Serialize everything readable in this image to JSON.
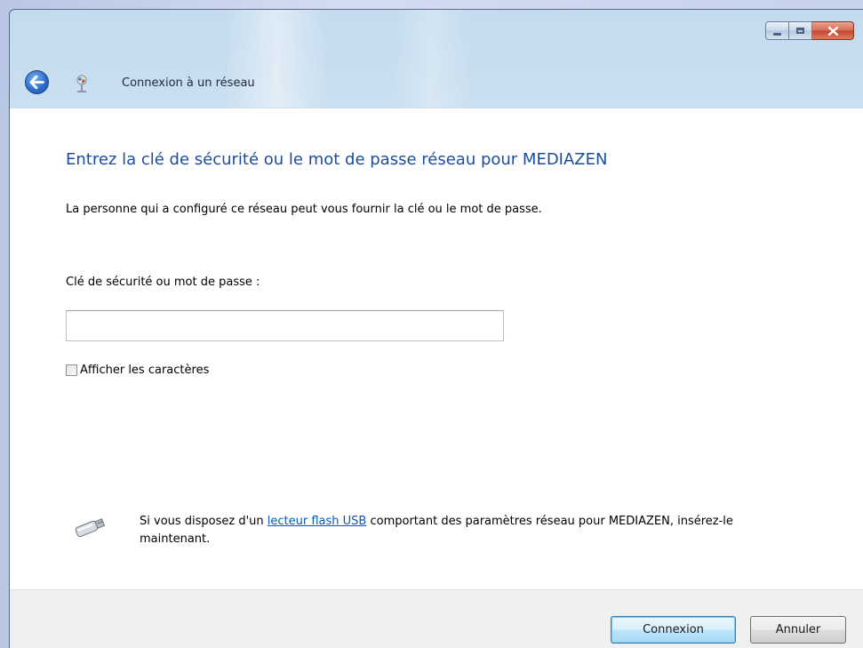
{
  "window": {
    "title": "Connexion à un réseau"
  },
  "content": {
    "heading": "Entrez la clé de sécurité ou le mot de passe réseau pour MEDIAZEN",
    "description": "La personne qui a configuré ce réseau peut vous fournir la clé ou le mot de passe.",
    "key_label": "Clé de sécurité ou mot de passe :",
    "key_value": "",
    "show_chars_label": "Afficher les caractères",
    "show_chars_checked": false,
    "usb_text_before": "Si vous disposez d'un ",
    "usb_link": "lecteur flash USB",
    "usb_text_after": " comportant des paramètres réseau pour MEDIAZEN, insérez-le maintenant."
  },
  "buttons": {
    "connect_label": "Connexion",
    "cancel_label": "Annuler"
  },
  "icons": {
    "back": "back-arrow-icon",
    "network": "network-wizard-icon",
    "usb": "usb-flash-drive-icon",
    "minimize": "minimize-icon",
    "maximize": "maximize-icon",
    "close": "close-icon"
  },
  "colors": {
    "heading": "#1b4d9c",
    "link": "#0a55c7",
    "close_button": "#c4452d",
    "back_button": "#2c6fcf"
  }
}
